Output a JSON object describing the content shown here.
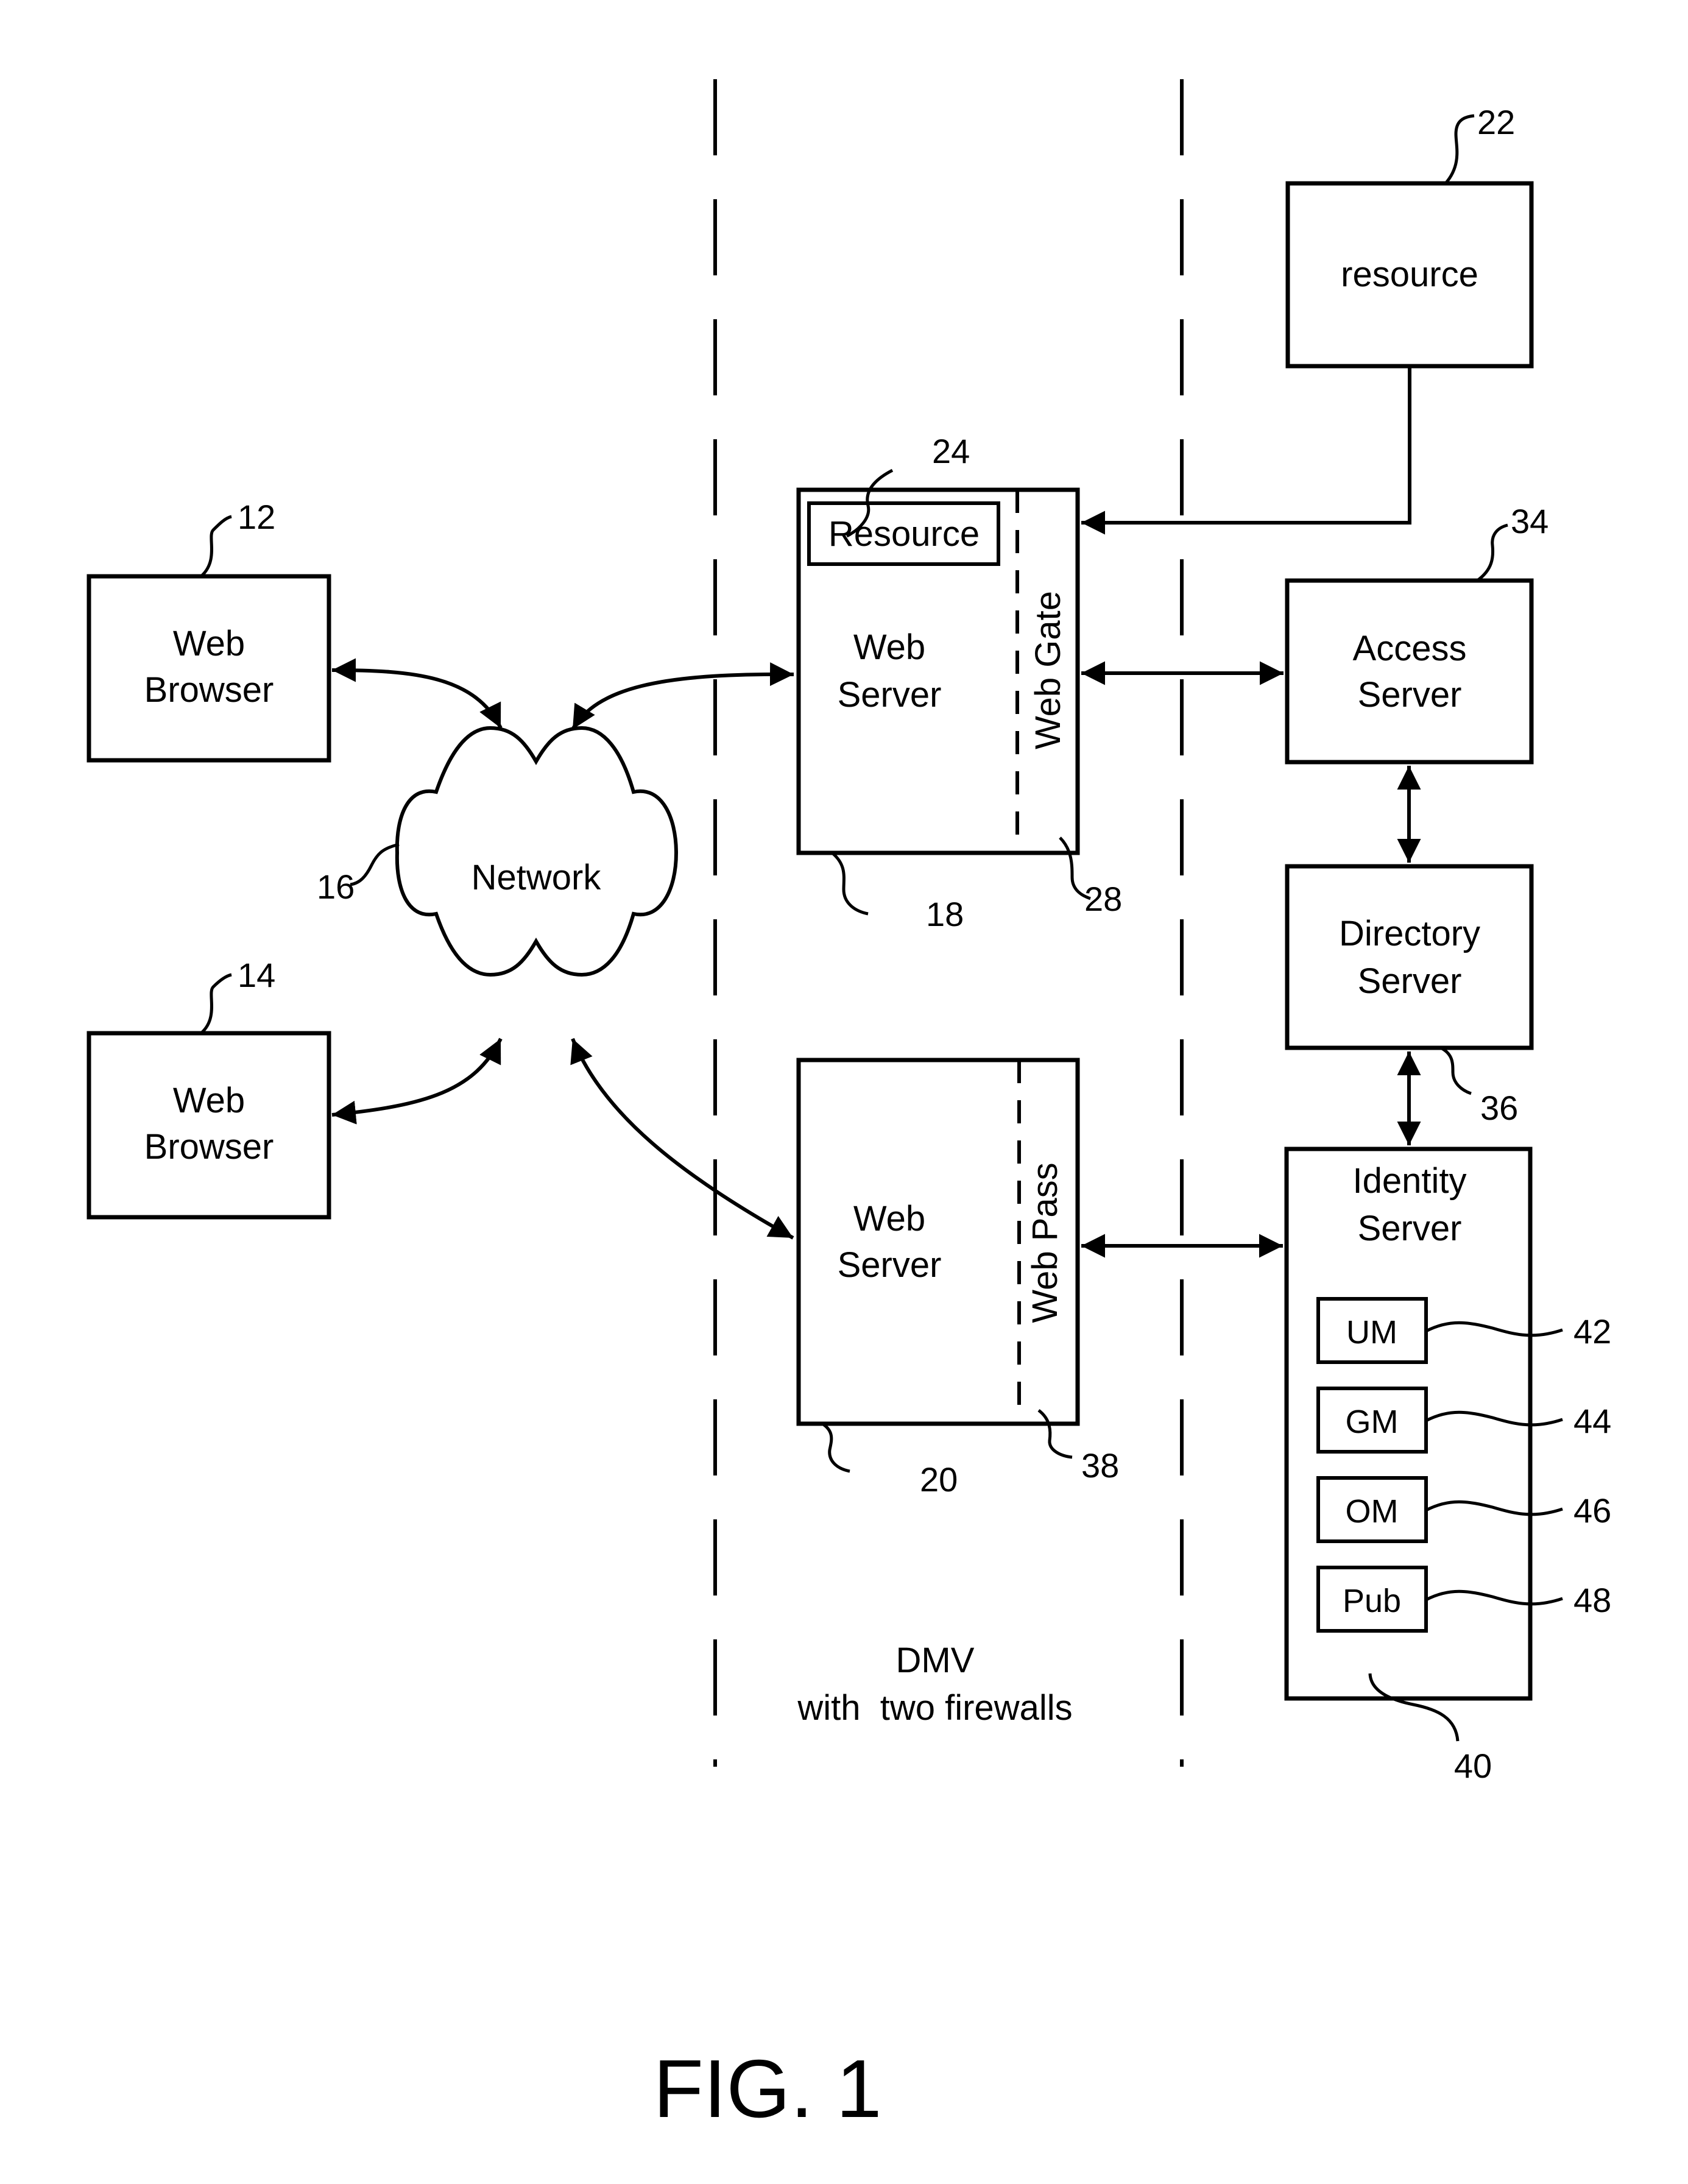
{
  "figure": {
    "caption": "FIG. 1",
    "zone_label_line1": "DMV",
    "zone_label_line2": "with  two firewalls"
  },
  "nodes": {
    "browser1": {
      "line1": "Web",
      "line2": "Browser",
      "ref": "12"
    },
    "browser2": {
      "line1": "Web",
      "line2": "Browser",
      "ref": "14"
    },
    "network": {
      "label": "Network",
      "ref": "16"
    },
    "webserver1": {
      "line1": "Web",
      "line2": "Server",
      "ref": "18",
      "plugin_label": "Web Gate",
      "plugin_ref": "28",
      "inner_resource_label": "Resource",
      "inner_resource_ref": "24"
    },
    "webserver2": {
      "line1": "Web",
      "line2": "Server",
      "ref": "20",
      "plugin_label": "Web Pass",
      "plugin_ref": "38"
    },
    "resource": {
      "label": "resource",
      "ref": "22"
    },
    "access_server": {
      "line1": "Access",
      "line2": "Server",
      "ref": "34"
    },
    "directory_server": {
      "line1": "Directory",
      "line2": "Server",
      "ref": "36"
    },
    "identity_server": {
      "line1": "Identity",
      "line2": "Server",
      "ref": "40",
      "modules": [
        {
          "label": "UM",
          "ref": "42"
        },
        {
          "label": "GM",
          "ref": "44"
        },
        {
          "label": "OM",
          "ref": "46"
        },
        {
          "label": "Pub",
          "ref": "48"
        }
      ]
    }
  },
  "edges": [
    {
      "from": "browser1",
      "to": "network",
      "direction": "bidirectional"
    },
    {
      "from": "browser2",
      "to": "network",
      "direction": "bidirectional"
    },
    {
      "from": "network",
      "to": "webserver1",
      "direction": "bidirectional"
    },
    {
      "from": "network",
      "to": "webserver2",
      "direction": "bidirectional"
    },
    {
      "from": "resource",
      "to": "webserver1",
      "direction": "unidirectional"
    },
    {
      "from": "webserver1",
      "to": "access_server",
      "direction": "bidirectional"
    },
    {
      "from": "access_server",
      "to": "directory_server",
      "direction": "bidirectional"
    },
    {
      "from": "directory_server",
      "to": "identity_server",
      "direction": "bidirectional"
    },
    {
      "from": "webserver2",
      "to": "identity_server",
      "direction": "bidirectional"
    }
  ]
}
